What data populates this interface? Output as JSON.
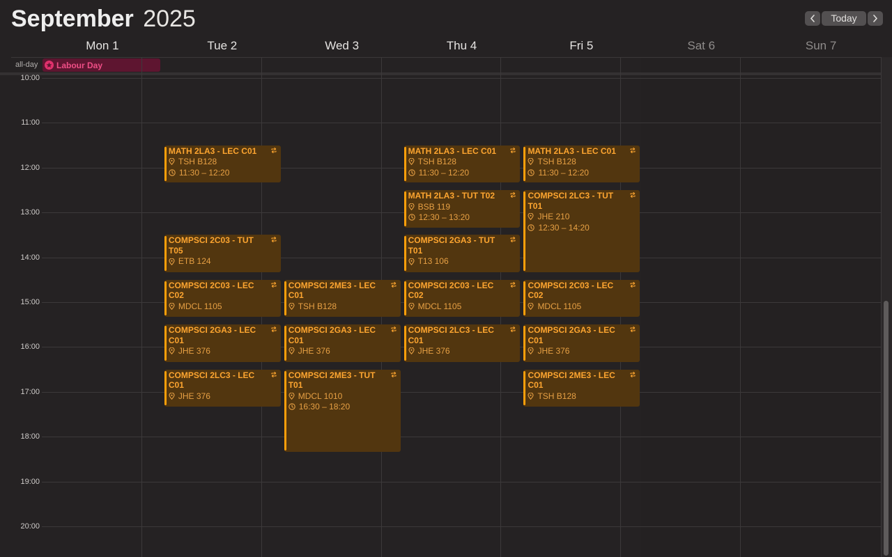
{
  "header": {
    "month": "September",
    "year": "2025",
    "today_label": "Today",
    "prev_icon": "chevron-left-icon",
    "next_icon": "chevron-right-icon"
  },
  "days": [
    {
      "label": "Mon 1",
      "weekend": false
    },
    {
      "label": "Tue 2",
      "weekend": false
    },
    {
      "label": "Wed 3",
      "weekend": false
    },
    {
      "label": "Thu 4",
      "weekend": false
    },
    {
      "label": "Fri 5",
      "weekend": false
    },
    {
      "label": "Sat 6",
      "weekend": true
    },
    {
      "label": "Sun 7",
      "weekend": true
    }
  ],
  "allday": {
    "label": "all-day",
    "events": [
      {
        "title": "Labour Day",
        "day": 0,
        "icon": "star-icon",
        "color": "#e0316c"
      }
    ]
  },
  "hours": [
    "10:00",
    "11:00",
    "12:00",
    "13:00",
    "14:00",
    "15:00",
    "16:00",
    "17:00",
    "18:00",
    "19:00",
    "20:00"
  ],
  "colors": {
    "event_fill": "#52360f",
    "event_accent": "#ff9f0a",
    "event_text": "#fda530",
    "holiday": "#e0316c",
    "background": "#252223"
  },
  "events": [
    {
      "day": 1,
      "start": "11:30",
      "end": "12:20",
      "title": "MATH 2LA3 - LEC C01",
      "location": "TSH B128",
      "time": "11:30 – 12:20",
      "show_time": true
    },
    {
      "day": 1,
      "start": "13:30",
      "end": "14:20",
      "title": "COMPSCI 2C03 - TUT T05",
      "location": "ETB 124",
      "time": "13:30 – 14:20",
      "show_time": false
    },
    {
      "day": 1,
      "start": "14:30",
      "end": "15:20",
      "title": "COMPSCI 2C03 - LEC C02",
      "location": "MDCL 1105",
      "time": "14:30 – 15:20",
      "show_time": false
    },
    {
      "day": 1,
      "start": "15:30",
      "end": "16:20",
      "title": "COMPSCI 2GA3 - LEC C01",
      "location": "JHE 376",
      "time": "15:30 – 16:20",
      "show_time": false
    },
    {
      "day": 1,
      "start": "16:30",
      "end": "17:20",
      "title": "COMPSCI 2LC3 - LEC C01",
      "location": "JHE 376",
      "time": "16:30 – 17:20",
      "show_time": false
    },
    {
      "day": 2,
      "start": "14:30",
      "end": "15:20",
      "title": "COMPSCI 2ME3 - LEC C01",
      "location": "TSH B128",
      "time": "14:30 – 15:20",
      "show_time": false
    },
    {
      "day": 2,
      "start": "15:30",
      "end": "16:20",
      "title": "COMPSCI 2GA3 - LEC C01",
      "location": "JHE 376",
      "time": "15:30 – 16:20",
      "show_time": false
    },
    {
      "day": 2,
      "start": "16:30",
      "end": "18:20",
      "title": "COMPSCI 2ME3 - TUT T01",
      "location": "MDCL 1010",
      "time": "16:30 – 18:20",
      "show_time": true
    },
    {
      "day": 3,
      "start": "11:30",
      "end": "12:20",
      "title": "MATH 2LA3 - LEC C01",
      "location": "TSH B128",
      "time": "11:30 – 12:20",
      "show_time": true
    },
    {
      "day": 3,
      "start": "12:30",
      "end": "13:20",
      "title": "MATH 2LA3 - TUT T02",
      "location": "BSB 119",
      "time": "12:30 – 13:20",
      "show_time": true
    },
    {
      "day": 3,
      "start": "13:30",
      "end": "14:20",
      "title": "COMPSCI 2GA3 - TUT T01",
      "location": "T13 106",
      "time": "13:30 – 14:20",
      "show_time": false
    },
    {
      "day": 3,
      "start": "14:30",
      "end": "15:20",
      "title": "COMPSCI 2C03 - LEC C02",
      "location": "MDCL 1105",
      "time": "14:30 – 15:20",
      "show_time": false
    },
    {
      "day": 3,
      "start": "15:30",
      "end": "16:20",
      "title": "COMPSCI 2LC3 - LEC C01",
      "location": "JHE 376",
      "time": "15:30 – 16:20",
      "show_time": false
    },
    {
      "day": 4,
      "start": "11:30",
      "end": "12:20",
      "title": "MATH 2LA3 - LEC C01",
      "location": "TSH B128",
      "time": "11:30 – 12:20",
      "show_time": true
    },
    {
      "day": 4,
      "start": "12:30",
      "end": "14:20",
      "title": "COMPSCI 2LC3 - TUT T01",
      "location": "JHE 210",
      "time": "12:30 – 14:20",
      "show_time": true
    },
    {
      "day": 4,
      "start": "14:30",
      "end": "15:20",
      "title": "COMPSCI 2C03 - LEC C02",
      "location": "MDCL 1105",
      "time": "14:30 – 15:20",
      "show_time": false
    },
    {
      "day": 4,
      "start": "15:30",
      "end": "16:20",
      "title": "COMPSCI 2GA3 - LEC C01",
      "location": "JHE 376",
      "time": "15:30 – 16:20",
      "show_time": false
    },
    {
      "day": 4,
      "start": "16:30",
      "end": "17:20",
      "title": "COMPSCI 2ME3 - LEC C01",
      "location": "TSH B128",
      "time": "16:30 – 17:20",
      "show_time": false
    }
  ]
}
